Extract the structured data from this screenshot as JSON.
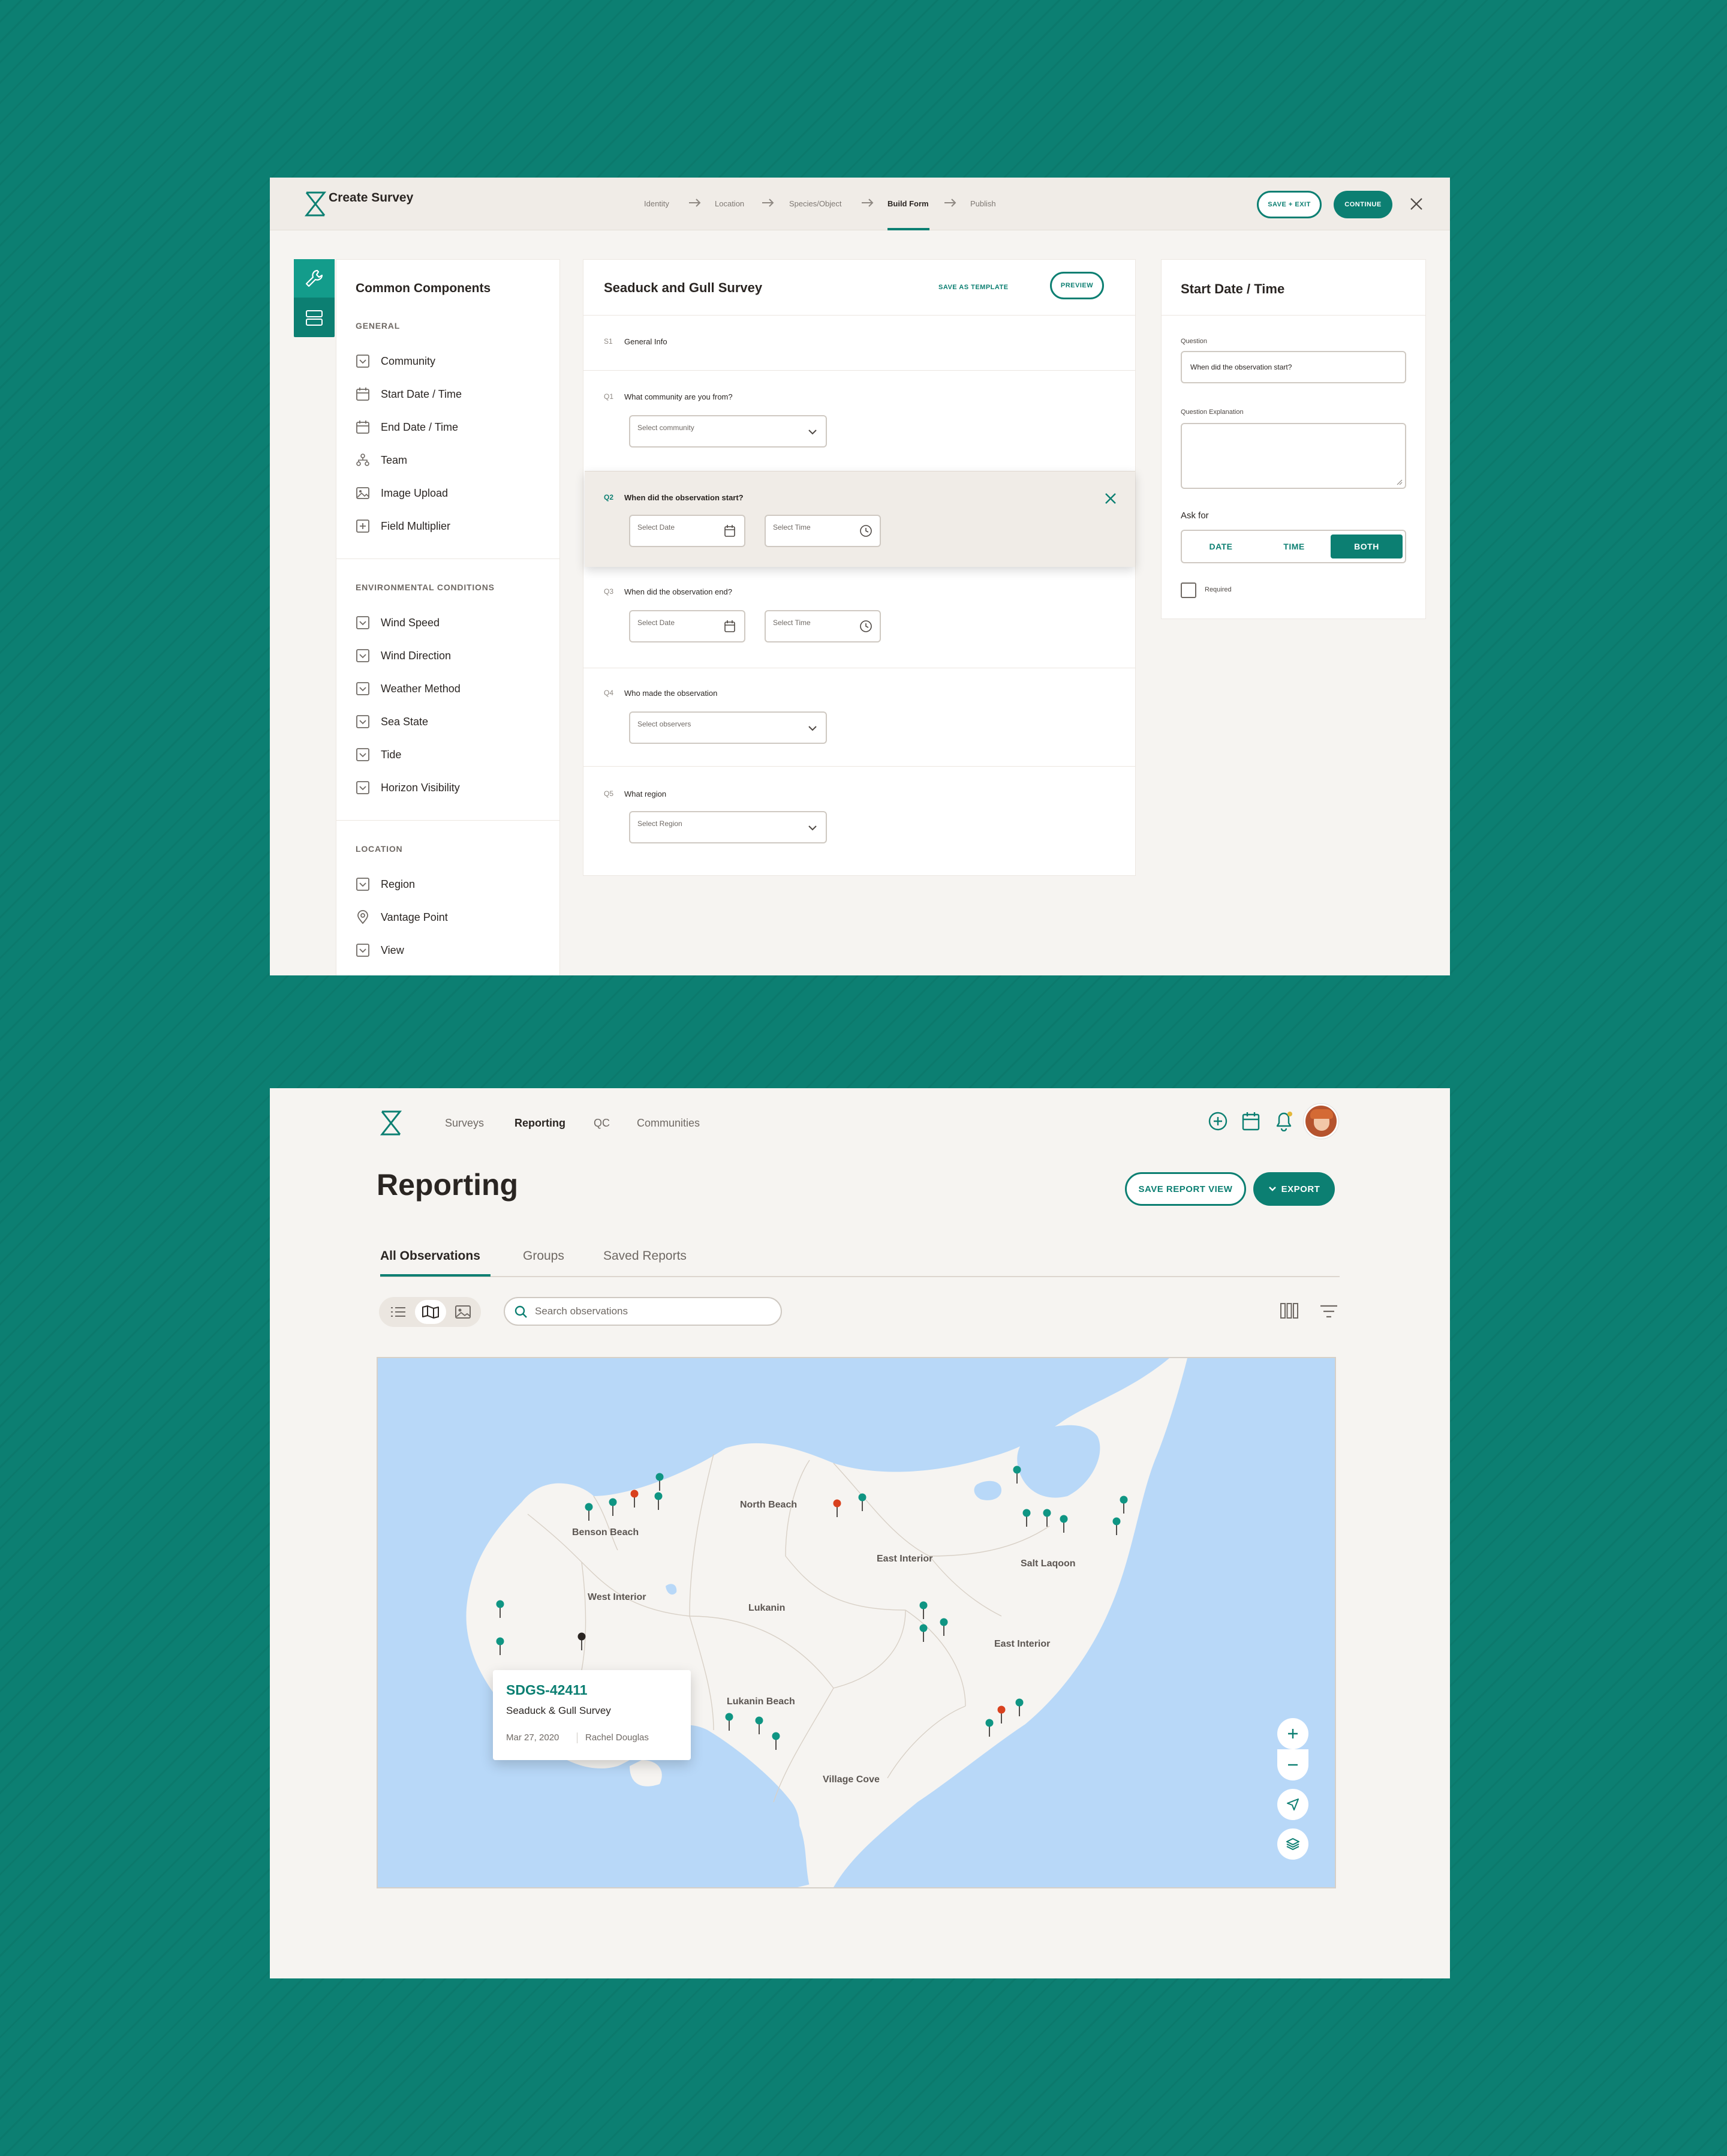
{
  "colors": {
    "teal": "#0c7f72",
    "teal_light": "#139c8b",
    "background": "#0c7f72",
    "pin_teal": "#0f9583",
    "pin_red": "#d9411e",
    "pin_dark": "#2a2522",
    "water": "#b8d8f8",
    "land": "#f6f4f1"
  },
  "builder": {
    "title": "Create Survey",
    "steps": [
      "Identity",
      "Location",
      "Species/Object",
      "Build Form",
      "Publish"
    ],
    "active_step": "Build Form",
    "save_exit": "SAVE + EXIT",
    "continue": "CONTINUE",
    "components": {
      "title": "Common Components",
      "general_head": "GENERAL",
      "general": [
        {
          "label": "Community",
          "icon": "dropdown-icon"
        },
        {
          "label": "Start Date / Time",
          "icon": "calendar-icon"
        },
        {
          "label": "End Date / Time",
          "icon": "calendar-icon"
        },
        {
          "label": "Team",
          "icon": "team-icon"
        },
        {
          "label": "Image Upload",
          "icon": "image-icon"
        },
        {
          "label": "Field Multiplier",
          "icon": "field-multiplier-icon"
        }
      ],
      "env_head": "ENVIRONMENTAL CONDITIONS",
      "env": [
        {
          "label": "Wind Speed",
          "icon": "dropdown-icon"
        },
        {
          "label": "Wind Direction",
          "icon": "dropdown-icon"
        },
        {
          "label": "Weather Method",
          "icon": "dropdown-icon"
        },
        {
          "label": "Sea State",
          "icon": "dropdown-icon"
        },
        {
          "label": "Tide",
          "icon": "dropdown-icon"
        },
        {
          "label": "Horizon Visibility",
          "icon": "dropdown-icon"
        }
      ],
      "loc_head": "LOCATION",
      "loc": [
        {
          "label": "Region",
          "icon": "dropdown-icon"
        },
        {
          "label": "Vantage Point",
          "icon": "location-pin-icon"
        },
        {
          "label": "View",
          "icon": "dropdown-icon"
        }
      ]
    },
    "form": {
      "title": "Seaduck and Gull Survey",
      "save_template": "SAVE AS TEMPLATE",
      "preview": "PREVIEW",
      "section": {
        "num": "S1",
        "text": "General Info"
      },
      "q1": {
        "num": "Q1",
        "text": "What community are you from?",
        "placeholder": "Select community"
      },
      "q2": {
        "num": "Q2",
        "text": "When did the observation start?",
        "date": "Select Date",
        "time": "Select Time"
      },
      "q3": {
        "num": "Q3",
        "text": "When did the observation end?",
        "date": "Select Date",
        "time": "Select Time"
      },
      "q4": {
        "num": "Q4",
        "text": "Who made the observation",
        "placeholder": "Select observers"
      },
      "q5": {
        "num": "Q5",
        "text": "What region",
        "placeholder": "Select Region"
      }
    },
    "props": {
      "title": "Start Date / Time",
      "question_label": "Question",
      "question_value": "When did the observation start?",
      "explanation_label": "Question Explanation",
      "ask_for": "Ask for",
      "options": [
        "DATE",
        "TIME",
        "BOTH"
      ],
      "selected": "BOTH",
      "required": "Required"
    }
  },
  "reporting": {
    "nav": [
      "Surveys",
      "Reporting",
      "QC",
      "Communities"
    ],
    "active_nav": "Reporting",
    "title": "Reporting",
    "save_view": "SAVE REPORT VIEW",
    "export": "EXPORT",
    "tabs": [
      "All Observations",
      "Groups",
      "Saved Reports"
    ],
    "active_tab": "All Observations",
    "search_placeholder": "Search observations",
    "view_mode": "map",
    "map_labels": [
      "Benson Beach",
      "North Beach",
      "East Interior",
      "Salt Laqoon",
      "West Interior",
      "Lukanin",
      "East Interior",
      "Lukanin Beach",
      "Village Cove"
    ],
    "popup": {
      "id": "SDGS-42411",
      "survey": "Seaduck & Gull Survey",
      "date": "Mar 27, 2020",
      "observer": "Rachel Douglas"
    },
    "map_controls": [
      "zoom-in",
      "zoom-out",
      "locate",
      "layers"
    ]
  }
}
